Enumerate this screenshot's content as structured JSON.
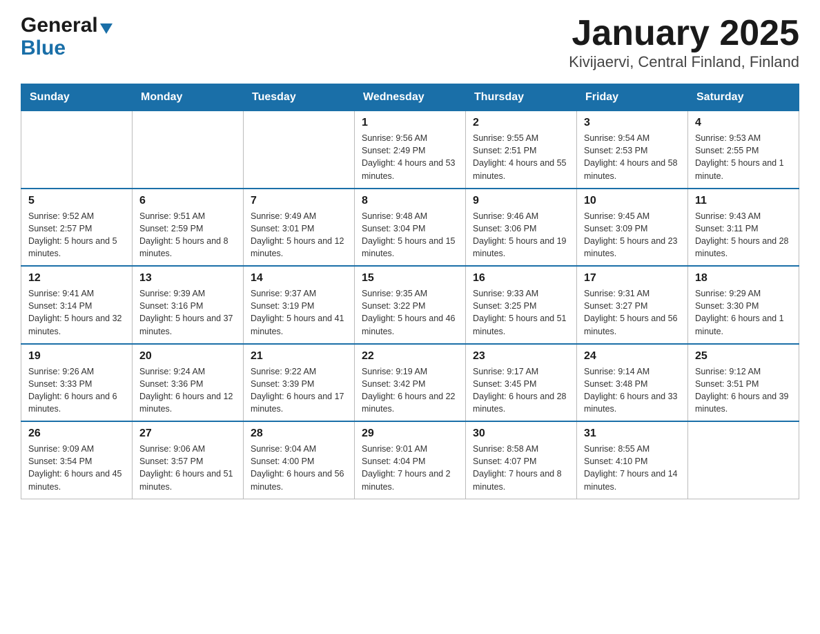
{
  "logo": {
    "general": "General",
    "triangle": "▼",
    "blue": "Blue"
  },
  "title": "January 2025",
  "subtitle": "Kivijaervi, Central Finland, Finland",
  "days_of_week": [
    "Sunday",
    "Monday",
    "Tuesday",
    "Wednesday",
    "Thursday",
    "Friday",
    "Saturday"
  ],
  "weeks": [
    [
      {
        "day": "",
        "info": ""
      },
      {
        "day": "",
        "info": ""
      },
      {
        "day": "",
        "info": ""
      },
      {
        "day": "1",
        "info": "Sunrise: 9:56 AM\nSunset: 2:49 PM\nDaylight: 4 hours\nand 53 minutes."
      },
      {
        "day": "2",
        "info": "Sunrise: 9:55 AM\nSunset: 2:51 PM\nDaylight: 4 hours\nand 55 minutes."
      },
      {
        "day": "3",
        "info": "Sunrise: 9:54 AM\nSunset: 2:53 PM\nDaylight: 4 hours\nand 58 minutes."
      },
      {
        "day": "4",
        "info": "Sunrise: 9:53 AM\nSunset: 2:55 PM\nDaylight: 5 hours\nand 1 minute."
      }
    ],
    [
      {
        "day": "5",
        "info": "Sunrise: 9:52 AM\nSunset: 2:57 PM\nDaylight: 5 hours\nand 5 minutes."
      },
      {
        "day": "6",
        "info": "Sunrise: 9:51 AM\nSunset: 2:59 PM\nDaylight: 5 hours\nand 8 minutes."
      },
      {
        "day": "7",
        "info": "Sunrise: 9:49 AM\nSunset: 3:01 PM\nDaylight: 5 hours\nand 12 minutes."
      },
      {
        "day": "8",
        "info": "Sunrise: 9:48 AM\nSunset: 3:04 PM\nDaylight: 5 hours\nand 15 minutes."
      },
      {
        "day": "9",
        "info": "Sunrise: 9:46 AM\nSunset: 3:06 PM\nDaylight: 5 hours\nand 19 minutes."
      },
      {
        "day": "10",
        "info": "Sunrise: 9:45 AM\nSunset: 3:09 PM\nDaylight: 5 hours\nand 23 minutes."
      },
      {
        "day": "11",
        "info": "Sunrise: 9:43 AM\nSunset: 3:11 PM\nDaylight: 5 hours\nand 28 minutes."
      }
    ],
    [
      {
        "day": "12",
        "info": "Sunrise: 9:41 AM\nSunset: 3:14 PM\nDaylight: 5 hours\nand 32 minutes."
      },
      {
        "day": "13",
        "info": "Sunrise: 9:39 AM\nSunset: 3:16 PM\nDaylight: 5 hours\nand 37 minutes."
      },
      {
        "day": "14",
        "info": "Sunrise: 9:37 AM\nSunset: 3:19 PM\nDaylight: 5 hours\nand 41 minutes."
      },
      {
        "day": "15",
        "info": "Sunrise: 9:35 AM\nSunset: 3:22 PM\nDaylight: 5 hours\nand 46 minutes."
      },
      {
        "day": "16",
        "info": "Sunrise: 9:33 AM\nSunset: 3:25 PM\nDaylight: 5 hours\nand 51 minutes."
      },
      {
        "day": "17",
        "info": "Sunrise: 9:31 AM\nSunset: 3:27 PM\nDaylight: 5 hours\nand 56 minutes."
      },
      {
        "day": "18",
        "info": "Sunrise: 9:29 AM\nSunset: 3:30 PM\nDaylight: 6 hours\nand 1 minute."
      }
    ],
    [
      {
        "day": "19",
        "info": "Sunrise: 9:26 AM\nSunset: 3:33 PM\nDaylight: 6 hours\nand 6 minutes."
      },
      {
        "day": "20",
        "info": "Sunrise: 9:24 AM\nSunset: 3:36 PM\nDaylight: 6 hours\nand 12 minutes."
      },
      {
        "day": "21",
        "info": "Sunrise: 9:22 AM\nSunset: 3:39 PM\nDaylight: 6 hours\nand 17 minutes."
      },
      {
        "day": "22",
        "info": "Sunrise: 9:19 AM\nSunset: 3:42 PM\nDaylight: 6 hours\nand 22 minutes."
      },
      {
        "day": "23",
        "info": "Sunrise: 9:17 AM\nSunset: 3:45 PM\nDaylight: 6 hours\nand 28 minutes."
      },
      {
        "day": "24",
        "info": "Sunrise: 9:14 AM\nSunset: 3:48 PM\nDaylight: 6 hours\nand 33 minutes."
      },
      {
        "day": "25",
        "info": "Sunrise: 9:12 AM\nSunset: 3:51 PM\nDaylight: 6 hours\nand 39 minutes."
      }
    ],
    [
      {
        "day": "26",
        "info": "Sunrise: 9:09 AM\nSunset: 3:54 PM\nDaylight: 6 hours\nand 45 minutes."
      },
      {
        "day": "27",
        "info": "Sunrise: 9:06 AM\nSunset: 3:57 PM\nDaylight: 6 hours\nand 51 minutes."
      },
      {
        "day": "28",
        "info": "Sunrise: 9:04 AM\nSunset: 4:00 PM\nDaylight: 6 hours\nand 56 minutes."
      },
      {
        "day": "29",
        "info": "Sunrise: 9:01 AM\nSunset: 4:04 PM\nDaylight: 7 hours\nand 2 minutes."
      },
      {
        "day": "30",
        "info": "Sunrise: 8:58 AM\nSunset: 4:07 PM\nDaylight: 7 hours\nand 8 minutes."
      },
      {
        "day": "31",
        "info": "Sunrise: 8:55 AM\nSunset: 4:10 PM\nDaylight: 7 hours\nand 14 minutes."
      },
      {
        "day": "",
        "info": ""
      }
    ]
  ]
}
